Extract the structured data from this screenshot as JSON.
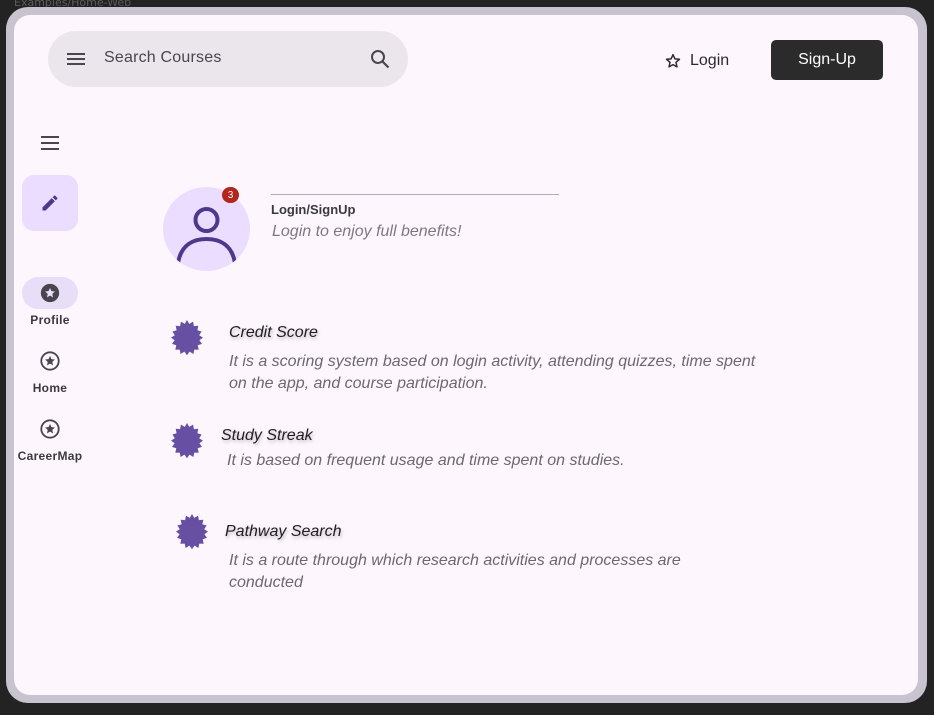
{
  "frame_caption": "Examples/Home-Web",
  "header": {
    "search_placeholder": "Search Courses",
    "login_label": "Login",
    "signup_label": "Sign-Up"
  },
  "rail": {
    "items": [
      {
        "label": "Profile",
        "icon": "star-circle-filled-icon",
        "active": true
      },
      {
        "label": "Home",
        "icon": "star-circle-outline-icon",
        "active": false
      },
      {
        "label": "CareerMap",
        "icon": "star-circle-outline-icon",
        "active": false
      }
    ]
  },
  "profile": {
    "badge_count": "3",
    "title": "Login/SignUp",
    "subtitle": "Login to enjoy full benefits!"
  },
  "features": [
    {
      "title": "Credit Score",
      "description": "It is a scoring system based on login activity, attending quizzes, time spent on the app, and course participation."
    },
    {
      "title": "Study Streak",
      "description": "It is based on frequent usage and time spent on studies."
    },
    {
      "title": "Pathway Search",
      "description": "It is a route through which research activities and processes are conducted"
    }
  ],
  "colors": {
    "accent": "#6750a4",
    "container": "#eaddff",
    "badge": "#b3261e",
    "surface": "#fdf7fd"
  }
}
